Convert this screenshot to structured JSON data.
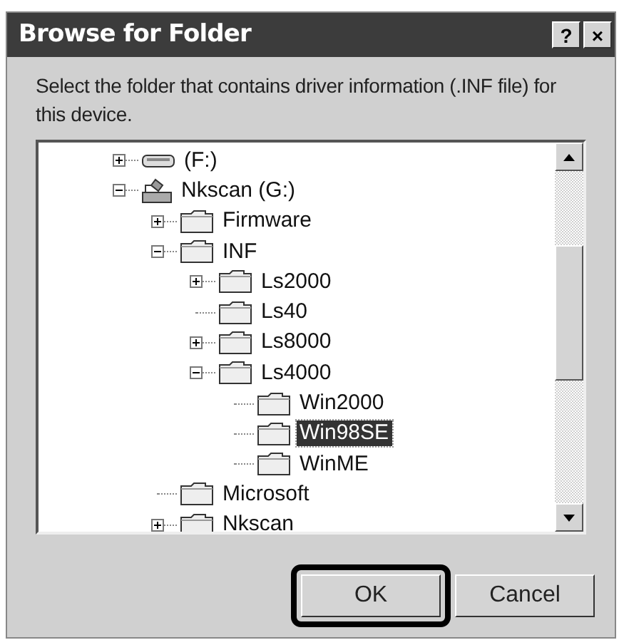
{
  "window": {
    "title": "Browse for Folder",
    "buttons": [
      "?",
      "×"
    ]
  },
  "prompt": "Select the folder that contains driver information (.INF file) for this device.",
  "tree": [
    {
      "label": "(F:)",
      "kind": "drive",
      "expanded": false,
      "selected": false
    },
    {
      "label": "Nkscan (G:)",
      "kind": "shared-drive",
      "expanded": true,
      "selected": false,
      "children": [
        {
          "label": "Firmware",
          "kind": "folder",
          "expanded": false,
          "selected": false
        },
        {
          "label": "INF",
          "kind": "folder",
          "expanded": true,
          "selected": false,
          "children": [
            {
              "label": "Ls2000",
              "kind": "folder",
              "expanded": false,
              "selected": false
            },
            {
              "label": "Ls40",
              "kind": "folder",
              "selected": false
            },
            {
              "label": "Ls8000",
              "kind": "folder",
              "expanded": false,
              "selected": false
            },
            {
              "label": "Ls4000",
              "kind": "folder",
              "expanded": true,
              "selected": false,
              "children": [
                {
                  "label": "Win2000",
                  "kind": "folder",
                  "selected": false
                },
                {
                  "label": "Win98SE",
                  "kind": "folder",
                  "selected": true
                },
                {
                  "label": "WinME",
                  "kind": "folder",
                  "selected": false
                }
              ]
            }
          ]
        },
        {
          "label": "Microsoft",
          "kind": "folder",
          "selected": false
        },
        {
          "label": "Nkscan",
          "kind": "folder",
          "expanded": false,
          "selected": false
        }
      ]
    }
  ],
  "buttons": [
    {
      "label": "OK",
      "highlighted": true
    },
    {
      "label": "Cancel",
      "highlighted": false
    }
  ]
}
